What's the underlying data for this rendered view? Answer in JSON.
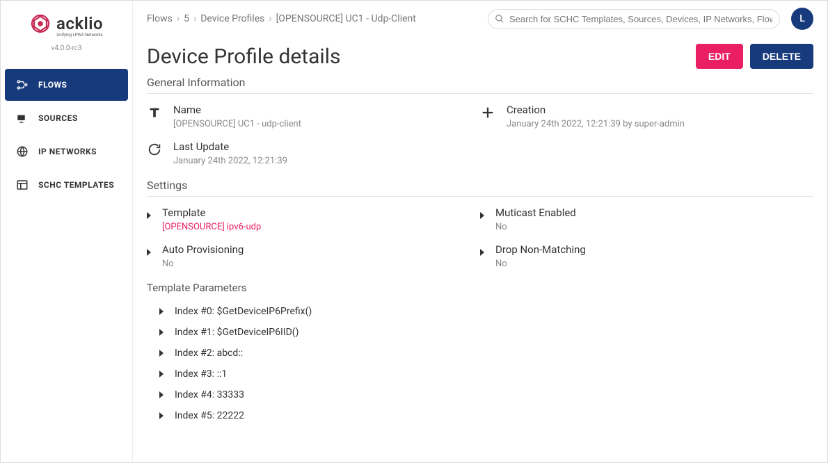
{
  "brand": {
    "name": "acklio",
    "tagline": "Unifying LPWA Networks",
    "version": "v4.0.0-rc3"
  },
  "sidebar": {
    "items": [
      {
        "label": "FLOWS",
        "icon": "flows",
        "active": true
      },
      {
        "label": "SOURCES",
        "icon": "sources",
        "active": false
      },
      {
        "label": "IP NETWORKS",
        "icon": "globe",
        "active": false
      },
      {
        "label": "SCHC TEMPLATES",
        "icon": "templates",
        "active": false
      }
    ]
  },
  "breadcrumb": [
    {
      "label": "Flows"
    },
    {
      "label": "5"
    },
    {
      "label": "Device Profiles"
    },
    {
      "label": "[OPENSOURCE] UC1 - Udp-Client"
    }
  ],
  "search": {
    "placeholder": "Search for SCHC Templates, Sources, Devices, IP Networks, Flows"
  },
  "avatar": {
    "initial": "L"
  },
  "page": {
    "title": "Device Profile details",
    "actions": {
      "edit": "EDIT",
      "delete": "DELETE"
    },
    "sections": {
      "general": {
        "header": "General Information",
        "name": {
          "label": "Name",
          "value": "[OPENSOURCE] UC1 - udp-client"
        },
        "creation": {
          "label": "Creation",
          "value": "January 24th 2022, 12:21:39 by super-admin"
        },
        "last_update": {
          "label": "Last Update",
          "value": "January 24th 2022, 12:21:39"
        }
      },
      "settings": {
        "header": "Settings",
        "template": {
          "label": "Template",
          "value": "[OPENSOURCE] ipv6-udp"
        },
        "multicast": {
          "label": "Muticast Enabled",
          "value": "No"
        },
        "auto_provisioning": {
          "label": "Auto Provisioning",
          "value": "No"
        },
        "drop_non_matching": {
          "label": "Drop Non-Matching",
          "value": "No"
        }
      },
      "template_parameters": {
        "header": "Template Parameters",
        "items": [
          "Index #0: $GetDeviceIP6Prefix()",
          "Index #1: $GetDeviceIP6IID()",
          "Index #2: abcd::",
          "Index #3: ::1",
          "Index #4: 33333",
          "Index #5: 22222"
        ]
      }
    }
  }
}
